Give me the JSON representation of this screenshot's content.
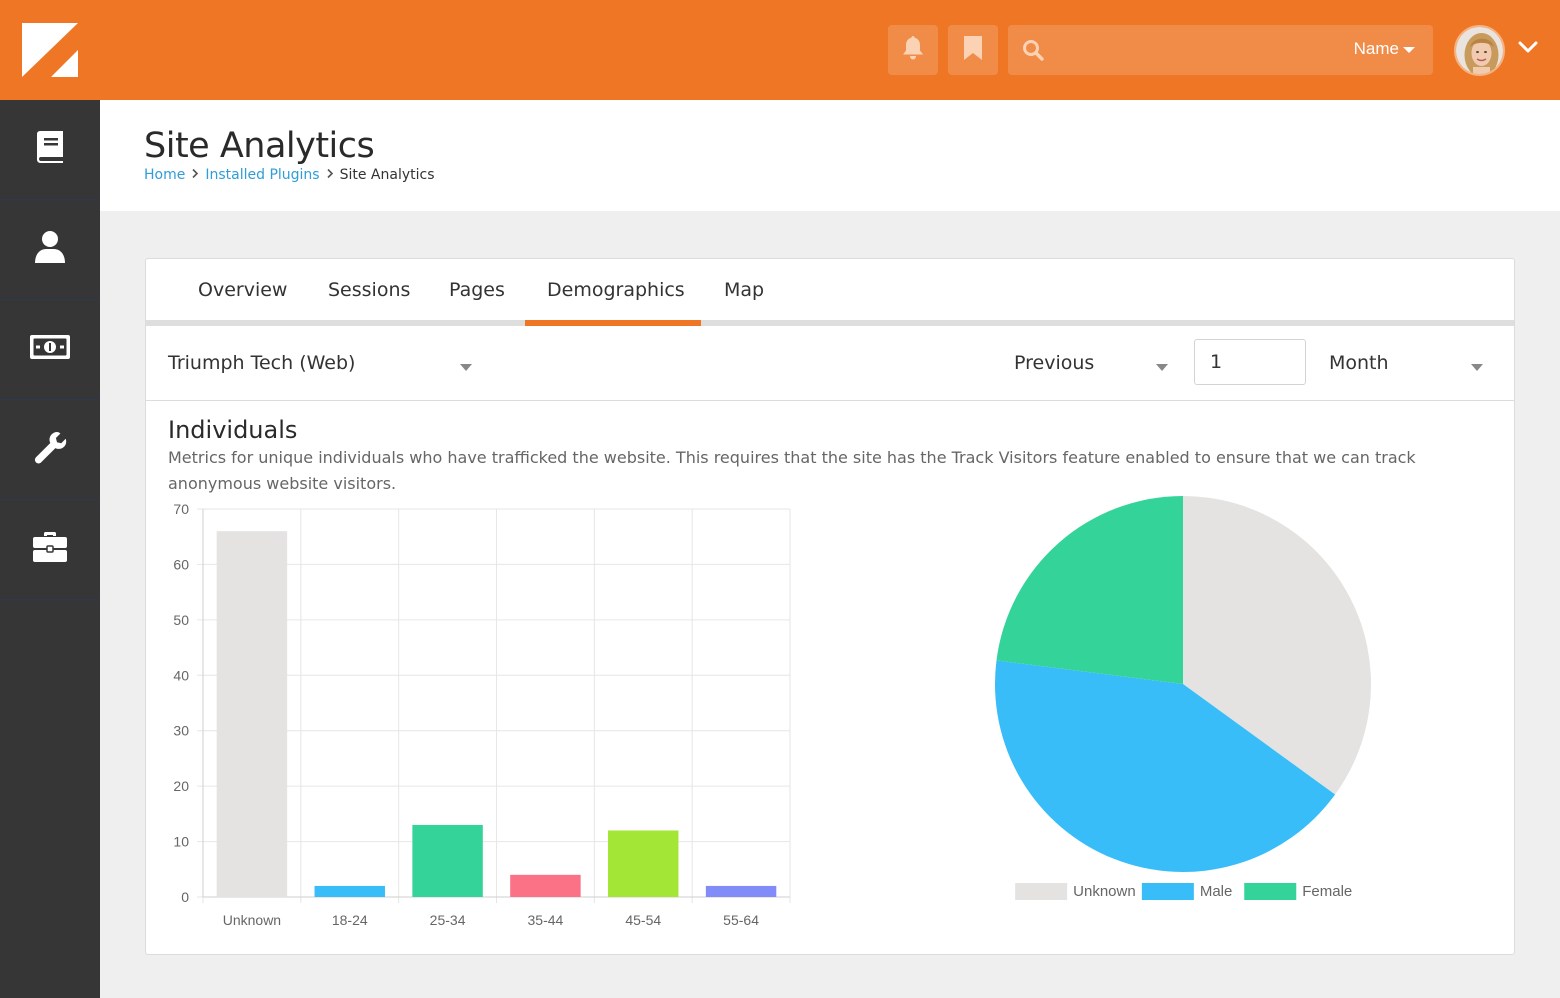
{
  "header": {
    "logo": "rock-logo",
    "notifications_icon": "bell-icon",
    "bookmarks_icon": "bookmark-icon",
    "search": {
      "placeholder": "",
      "filter_label": "Name",
      "icon": "search-icon"
    },
    "avatar": "user-avatar",
    "accent_color": "#ee7625"
  },
  "sidebar": {
    "items": [
      {
        "icon": "book-icon"
      },
      {
        "icon": "person-icon"
      },
      {
        "icon": "money-icon"
      },
      {
        "icon": "wrench-icon"
      },
      {
        "icon": "briefcase-icon"
      }
    ]
  },
  "page": {
    "title": "Site Analytics",
    "breadcrumb": [
      "Home",
      "Installed Plugins",
      "Site Analytics"
    ]
  },
  "tabs": [
    {
      "label": "Overview",
      "active": false
    },
    {
      "label": "Sessions",
      "active": false
    },
    {
      "label": "Pages",
      "active": false
    },
    {
      "label": "Demographics",
      "active": true
    },
    {
      "label": "Map",
      "active": false
    }
  ],
  "filters": {
    "site": "Triumph Tech (Web)",
    "range_type": "Previous",
    "range_count": "1",
    "range_unit": "Month"
  },
  "section": {
    "title": "Individuals",
    "description": "Metrics for unique individuals who have trafficked the website. This requires that the site has the Track Visitors feature enabled to ensure that we can track anonymous website visitors."
  },
  "chart_data": [
    {
      "type": "bar",
      "categories": [
        "Unknown",
        "18-24",
        "25-34",
        "35-44",
        "45-54",
        "55-64"
      ],
      "values": [
        66,
        2,
        13,
        4,
        12,
        2
      ],
      "colors": [
        "#e4e3e1",
        "#38bdf8",
        "#34d399",
        "#fb7185",
        "#a3e635",
        "#818cf8"
      ],
      "ylim": [
        0,
        70
      ],
      "yticks": [
        "0",
        "10",
        "20",
        "30",
        "40",
        "50",
        "60",
        "70"
      ],
      "grid": true
    },
    {
      "type": "pie",
      "labels": [
        "Unknown",
        "Male",
        "Female"
      ],
      "values": [
        35,
        42,
        23
      ],
      "colors": [
        "#e4e3e1",
        "#38bdf8",
        "#34d399"
      ],
      "legend_position": "bottom"
    }
  ]
}
